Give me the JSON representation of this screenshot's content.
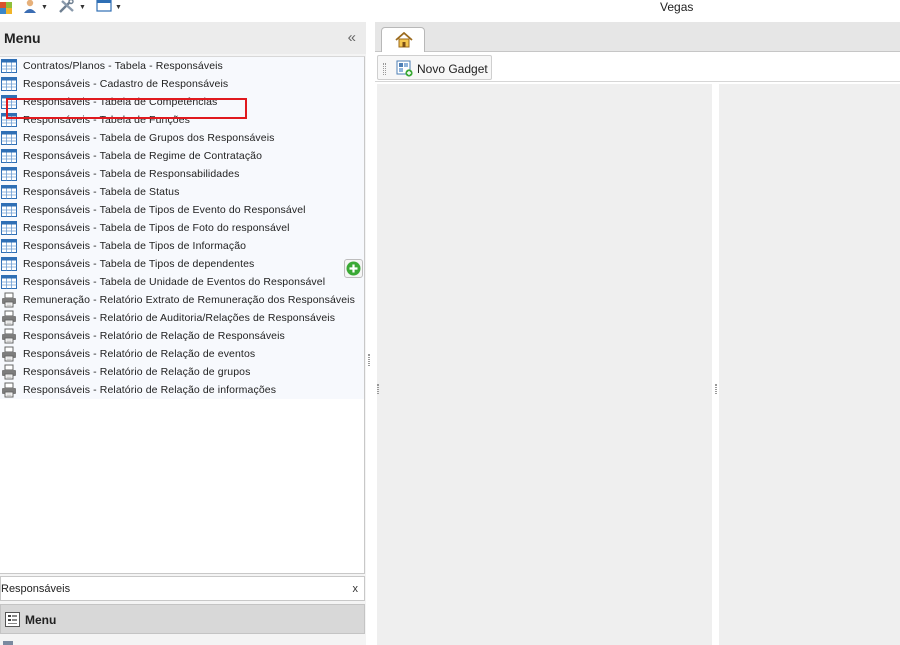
{
  "app": {
    "title": "Vegas"
  },
  "toolbar": {
    "items": [
      {
        "icon": "puzzle-icon"
      },
      {
        "icon": "user-icon"
      },
      {
        "icon": "tools-icon"
      },
      {
        "icon": "window-icon"
      }
    ]
  },
  "menu": {
    "title": "Menu",
    "collapse_glyph": "«",
    "items": [
      {
        "label": "Contratos/Planos - Tabela - Responsáveis",
        "icon": "table-icon"
      },
      {
        "label": "Responsáveis - Cadastro de Responsáveis",
        "icon": "table-icon"
      },
      {
        "label": "Responsáveis - Tabela de Competências",
        "icon": "table-icon"
      },
      {
        "label": "Responsáveis - Tabela de Funções",
        "icon": "table-icon"
      },
      {
        "label": "Responsáveis - Tabela de Grupos dos Responsáveis",
        "icon": "table-icon"
      },
      {
        "label": "Responsáveis - Tabela de Regime de Contratação",
        "icon": "table-icon"
      },
      {
        "label": "Responsáveis - Tabela de Responsabilidades",
        "icon": "table-icon"
      },
      {
        "label": "Responsáveis - Tabela de Status",
        "icon": "table-icon"
      },
      {
        "label": "Responsáveis - Tabela de Tipos de Evento do Responsável",
        "icon": "table-icon"
      },
      {
        "label": "Responsáveis - Tabela de Tipos de Foto do responsável",
        "icon": "table-icon"
      },
      {
        "label": "Responsáveis - Tabela de Tipos de Informação",
        "icon": "table-icon"
      },
      {
        "label": "Responsáveis - Tabela de Tipos de dependentes",
        "icon": "table-icon"
      },
      {
        "label": "Responsáveis - Tabela de Unidade de Eventos do Responsável",
        "icon": "table-icon"
      },
      {
        "label": "Remuneração - Relatório Extrato de Remuneração dos Responsáveis",
        "icon": "printer-icon"
      },
      {
        "label": "Responsáveis - Relatório de Auditoria/Relações de Responsáveis",
        "icon": "printer-icon"
      },
      {
        "label": "Responsáveis - Relatório de Relação de Responsáveis",
        "icon": "printer-icon"
      },
      {
        "label": "Responsáveis - Relatório de Relação de eventos",
        "icon": "printer-icon"
      },
      {
        "label": "Responsáveis - Relatório de Relação de grupos",
        "icon": "printer-icon"
      },
      {
        "label": "Responsáveis - Relatório de Relação de informações",
        "icon": "printer-icon"
      }
    ],
    "highlighted_item": "Responsáveis - Cadastro de Responsáveis",
    "search": {
      "value": "Responsáveis",
      "clear_glyph": "x"
    },
    "footer_label": "Menu"
  },
  "workspace": {
    "home_tab_icon": "home-icon",
    "new_gadget_label": "Novo Gadget"
  },
  "colors": {
    "highlight": "#e0191e",
    "add_green": "#3aa935",
    "icon_blue": "#2f6fb5"
  }
}
